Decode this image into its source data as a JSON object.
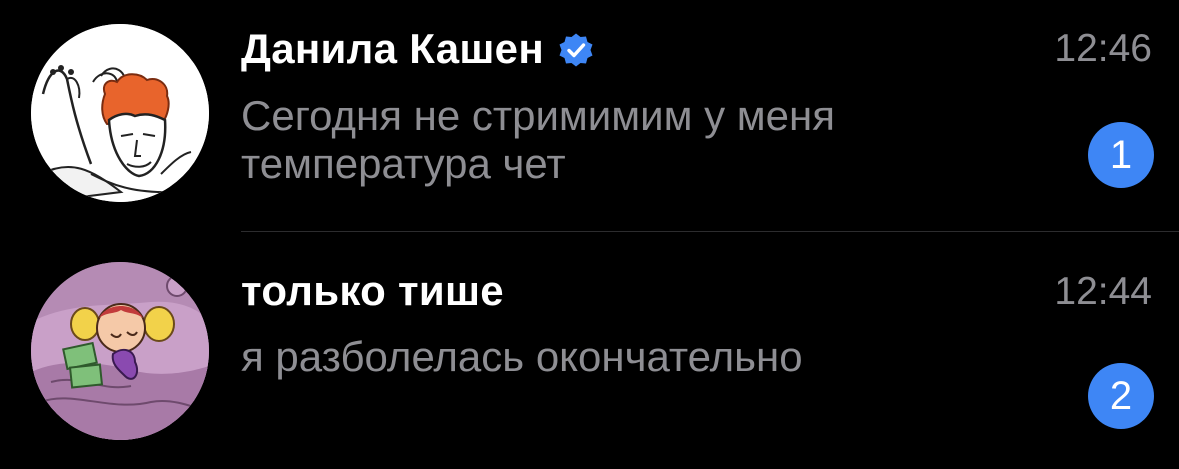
{
  "colors": {
    "background": "#000000",
    "secondary_text": "#8e8e93",
    "badge": "#3e86f5",
    "verified": "#3e86f5"
  },
  "chats": [
    {
      "name": "Данила Кашен",
      "verified": true,
      "verified_icon": "verified-badge-icon",
      "time": "12:46",
      "preview": "Сегодня не стримимим у меня температура чет",
      "unread": "1"
    },
    {
      "name": "только тише",
      "verified": false,
      "time": "12:44",
      "preview": "я разболелась окончательно",
      "unread": "2"
    }
  ]
}
